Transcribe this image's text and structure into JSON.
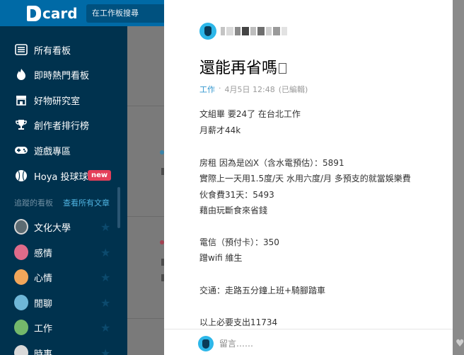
{
  "header": {
    "logo_text": "card",
    "search_placeholder": "在工作板搜尋"
  },
  "sidebar": {
    "items": [
      {
        "label": "所有看板",
        "icon": "list-icon"
      },
      {
        "label": "即時熱門看板",
        "icon": "flame-icon"
      },
      {
        "label": "好物研究室",
        "icon": "shop-icon"
      },
      {
        "label": "創作者排行榜",
        "icon": "trophy-icon"
      },
      {
        "label": "遊戲專區",
        "icon": "gamepad-icon"
      },
      {
        "label": "Hoya 投球球",
        "icon": "baseball-icon",
        "badge": "new"
      }
    ],
    "followed_title": "追蹤的看板",
    "view_all": "查看所有文章",
    "followed": [
      {
        "label": "文化大學",
        "icon": "school-avatar",
        "color": "#5c6b72"
      },
      {
        "label": "感情",
        "icon": "heart-avatar",
        "color": "#e06b8a"
      },
      {
        "label": "心情",
        "icon": "mood-avatar",
        "color": "#f2a65a"
      },
      {
        "label": "閒聊",
        "icon": "chat-avatar",
        "color": "#6fb7d8"
      },
      {
        "label": "工作",
        "icon": "work-avatar",
        "color": "#74b86b"
      },
      {
        "label": "時事",
        "icon": "news-avatar",
        "color": "#d9d9d9"
      }
    ]
  },
  "post": {
    "title": "還能再省嗎",
    "forum": "工作",
    "separator": "·",
    "timestamp": "4月5日 12:48",
    "edited": "(已編輯)",
    "body_lines": [
      "文組畢  要24了 在台北工作",
      "月薪才44k",
      "",
      "房租 因為是凶X（含水電預估）：5891",
      "實際上一天用1.5度/天  水用六度/月 多預支的就當娛樂費",
      "伙食費31天：5493",
      "藉由玩斷食來省錢",
      "",
      "電信（預付卡）：350",
      "蹭wifi 維生",
      "",
      "交通：走路五分鐘上班+騎腳踏車",
      "",
      "以上必要支出11734"
    ]
  },
  "comment": {
    "placeholder": "留言……"
  },
  "colors": {
    "brand": "#006aa6",
    "sidebar_bg": "#00324e",
    "link": "#3397cf",
    "new_badge": "#e43f5a"
  }
}
